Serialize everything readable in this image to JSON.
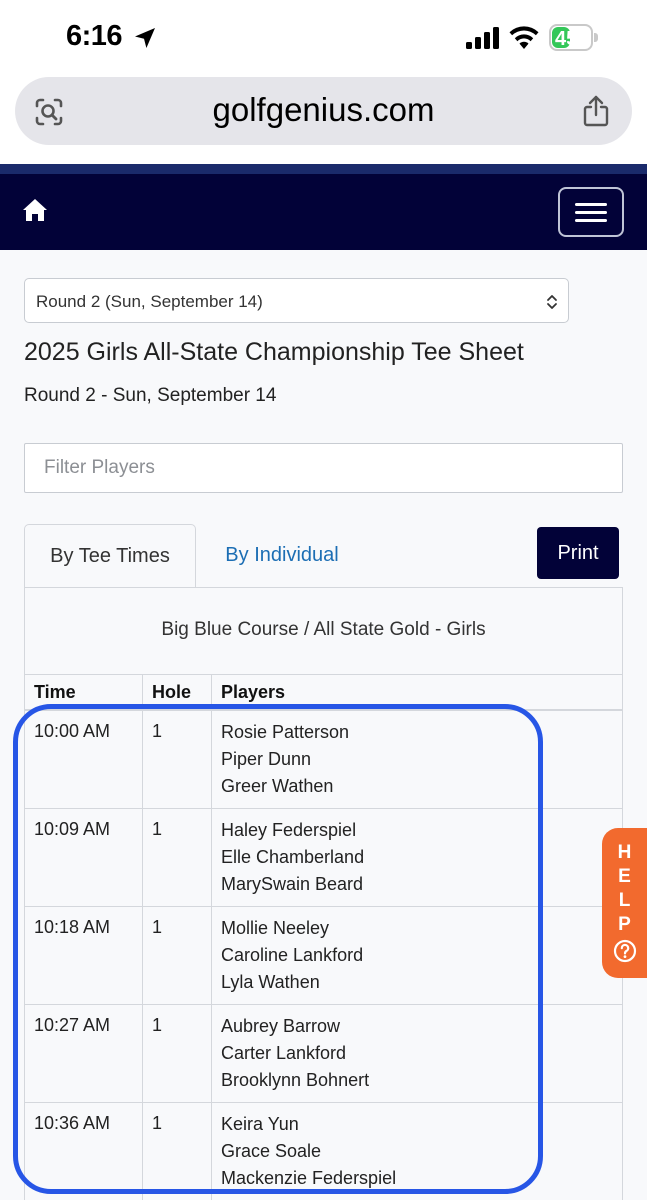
{
  "status_bar": {
    "time": "6:16",
    "battery": "45",
    "battery_level": 0.45
  },
  "browser": {
    "url": "golfgenius.com"
  },
  "navbar": {
    "home_icon": "home-icon",
    "menu_icon": "hamburger-menu-icon"
  },
  "round_select": {
    "value": "Round 2 (Sun, September 14)"
  },
  "page": {
    "title": "2025 Girls All-State Championship Tee Sheet",
    "subtitle": "Round 2 - Sun, September 14"
  },
  "filter": {
    "placeholder": "Filter Players"
  },
  "tabs": {
    "tee_times": "By Tee Times",
    "individual": "By Individual",
    "print": "Print"
  },
  "table": {
    "course": "Big Blue Course / All State Gold - Girls",
    "headers": {
      "time": "Time",
      "hole": "Hole",
      "players": "Players"
    },
    "rows": [
      {
        "time": "10:00 AM",
        "hole": "1",
        "players": [
          "Rosie Patterson",
          "Piper Dunn",
          "Greer Wathen"
        ]
      },
      {
        "time": "10:09 AM",
        "hole": "1",
        "players": [
          "Haley Federspiel",
          "Elle Chamberland",
          "MarySwain Beard"
        ]
      },
      {
        "time": "10:18 AM",
        "hole": "1",
        "players": [
          "Mollie Neeley",
          "Caroline Lankford",
          "Lyla Wathen"
        ]
      },
      {
        "time": "10:27 AM",
        "hole": "1",
        "players": [
          "Aubrey Barrow",
          "Carter Lankford",
          "Brooklynn Bohnert"
        ]
      },
      {
        "time": "10:36 AM",
        "hole": "1",
        "players": [
          "Keira Yun",
          "Grace Soale",
          "Mackenzie Federspiel"
        ]
      }
    ]
  },
  "help": {
    "letters": [
      "H",
      "E",
      "L",
      "P"
    ]
  },
  "colors": {
    "navbar": "#020238",
    "link": "#1c6eb4",
    "help": "#f26a2e",
    "highlight": "#2756e6",
    "battery": "#34c759"
  }
}
